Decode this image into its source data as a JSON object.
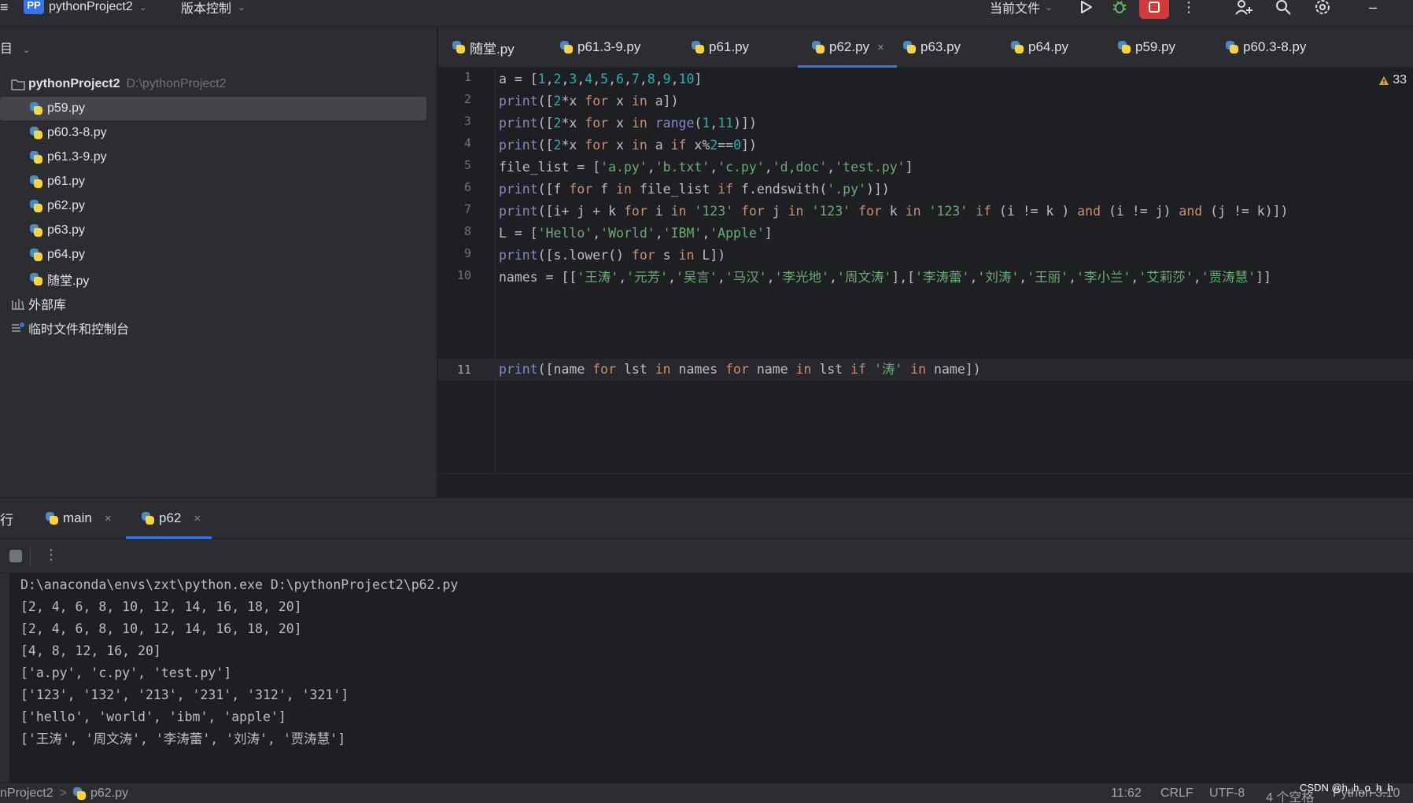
{
  "topbar": {
    "menu_glyph": "≡",
    "project_badge": "PP",
    "project_name": "pythonProject2",
    "vcs_label": "版本控制",
    "run_config": "当前文件"
  },
  "project_panel": {
    "header": "目",
    "root_name": "pythonProject2",
    "root_path": "D:\\pythonProject2",
    "files": [
      {
        "name": "p59.py"
      },
      {
        "name": "p60.3-8.py"
      },
      {
        "name": "p61.3-9.py"
      },
      {
        "name": "p61.py"
      },
      {
        "name": "p62.py"
      },
      {
        "name": "p63.py"
      },
      {
        "name": "p64.py"
      },
      {
        "name": "随堂.py"
      }
    ],
    "external_libs": "外部库",
    "scratches": "临时文件和控制台"
  },
  "editor_tabs": [
    {
      "label": "随堂.py"
    },
    {
      "label": "p61.3-9.py"
    },
    {
      "label": "p61.py"
    },
    {
      "label": "p62.py",
      "active": true,
      "close": "×"
    },
    {
      "label": "p63.py"
    },
    {
      "label": "p64.py"
    },
    {
      "label": "p59.py"
    },
    {
      "label": "p60.3-8.py"
    }
  ],
  "editor": {
    "line_numbers": [
      "1",
      "2",
      "3",
      "4",
      "5",
      "6",
      "7",
      "8",
      "9",
      "10",
      "11"
    ],
    "warnings_count": "33",
    "code_lines": [
      "a = [1,2,3,4,5,6,7,8,9,10]",
      "print([2*x for x in a])",
      "print([2*x for x in range(1,11)])",
      "print([2*x for x in a if x%2==0])",
      "file_list = ['a.py','b.txt','c.py','d,doc','test.py']",
      "print([f for f in file_list if f.endswith('.py')])",
      "print([i+ j + k for i in '123' for j in '123' for k in '123' if (i != k ) and (i != j) and (j != k)])",
      "L = ['Hello','World','IBM','Apple']",
      "print([s.lower() for s in L])",
      "names = [['王涛','元芳','吴言','马汉','李光地','周文涛'],['李涛蕾','刘涛','王丽','李小兰','艾莉莎','贾涛慧']]",
      "print([name for lst in names for name in lst if '涛' in name])"
    ]
  },
  "run_panel": {
    "title": "行",
    "tabs": [
      {
        "label": "main",
        "close": "×"
      },
      {
        "label": "p62",
        "close": "×",
        "active": true
      }
    ],
    "output": [
      "D:\\anaconda\\envs\\zxt\\python.exe D:\\pythonProject2\\p62.py",
      "[2, 4, 6, 8, 10, 12, 14, 16, 18, 20]",
      "[2, 4, 6, 8, 10, 12, 14, 16, 18, 20]",
      "[4, 8, 12, 16, 20]",
      "['a.py', 'c.py', 'test.py']",
      "['123', '132', '213', '231', '312', '321']",
      "['hello', 'world', 'ibm', 'apple']",
      "['王涛', '周文涛', '李涛蕾', '刘涛', '贾涛慧']"
    ]
  },
  "statusbar": {
    "breadcrumb_project": "nProject2",
    "breadcrumb_sep": ">",
    "breadcrumb_file": "p62.py",
    "position": "11:62",
    "line_ending": "CRLF",
    "encoding": "UTF-8",
    "indent": "4 个空格",
    "interpreter": "Python 3.10",
    "watermark": "CSDN @h_h_o_h_h"
  },
  "colors": {
    "accent": "#3574f0",
    "keyword": "#cf8e6d",
    "builtin": "#8888c6",
    "number": "#2aacb8",
    "string": "#6aab73",
    "stop_button": "#d33a3a"
  }
}
